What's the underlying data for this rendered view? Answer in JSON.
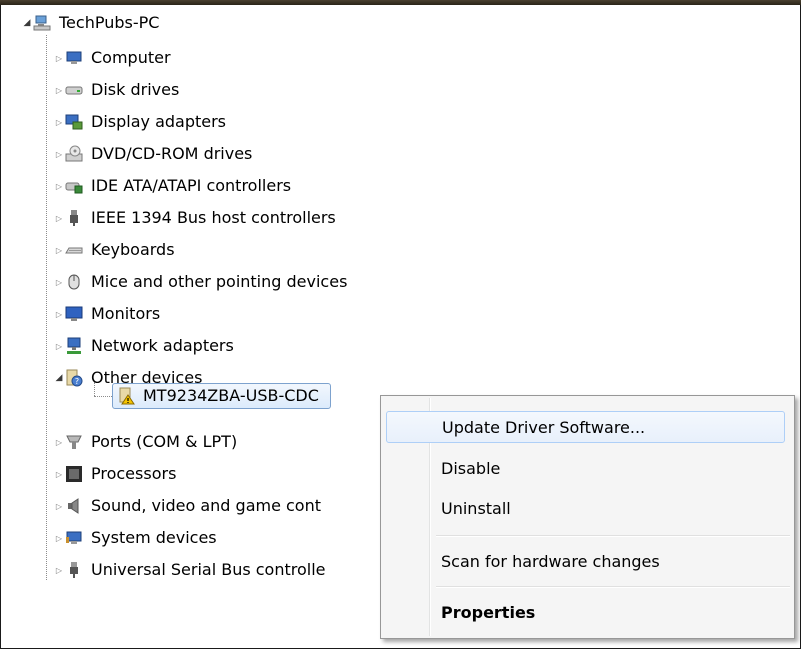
{
  "tree": {
    "root": {
      "label": "TechPubs-PC",
      "icon": "computer-network-icon"
    },
    "items": [
      {
        "label": "Computer",
        "icon": "computer-icon"
      },
      {
        "label": "Disk drives",
        "icon": "disk-drive-icon"
      },
      {
        "label": "Display adapters",
        "icon": "display-adapter-icon"
      },
      {
        "label": "DVD/CD-ROM drives",
        "icon": "dvd-drive-icon"
      },
      {
        "label": "IDE ATA/ATAPI controllers",
        "icon": "ide-controller-icon"
      },
      {
        "label": "IEEE 1394 Bus host controllers",
        "icon": "firewire-icon"
      },
      {
        "label": "Keyboards",
        "icon": "keyboard-icon"
      },
      {
        "label": "Mice and other pointing devices",
        "icon": "mouse-icon"
      },
      {
        "label": "Monitors",
        "icon": "monitor-icon"
      },
      {
        "label": "Network adapters",
        "icon": "network-adapter-icon"
      },
      {
        "label": "Other devices",
        "icon": "unknown-device-icon"
      },
      {
        "label": "Ports (COM & LPT)",
        "icon": "port-icon"
      },
      {
        "label": "Processors",
        "icon": "processor-icon"
      },
      {
        "label": "Sound, video and game cont",
        "icon": "speaker-icon"
      },
      {
        "label": "System devices",
        "icon": "system-devices-icon"
      },
      {
        "label": "Universal Serial Bus controlle",
        "icon": "usb-icon"
      }
    ],
    "child": {
      "label": "MT9234ZBA-USB-CDC",
      "icon": "warning-device-icon"
    }
  },
  "context_menu": {
    "update_driver": "Update Driver Software...",
    "disable": "Disable",
    "uninstall": "Uninstall",
    "scan": "Scan for hardware changes",
    "properties": "Properties"
  }
}
